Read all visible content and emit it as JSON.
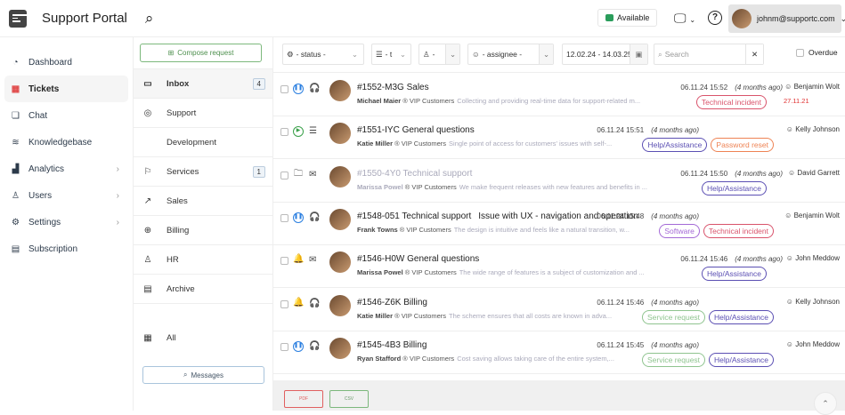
{
  "header": {
    "title": "Support Portal",
    "status": "Available",
    "user": "johnm@supportc.com"
  },
  "sidebar": {
    "items": [
      {
        "label": "Dashboard",
        "icon": "gauge-icon"
      },
      {
        "label": "Tickets",
        "icon": "grid-icon",
        "active": true
      },
      {
        "label": "Chat",
        "icon": "chat-icon"
      },
      {
        "label": "Knowledgebase",
        "icon": "layers-icon"
      },
      {
        "label": "Analytics",
        "icon": "chart-icon",
        "chevron": true
      },
      {
        "label": "Users",
        "icon": "users-icon",
        "chevron": true
      },
      {
        "label": "Settings",
        "icon": "gear-icon",
        "chevron": true
      },
      {
        "label": "Subscription",
        "icon": "calendar-icon"
      }
    ]
  },
  "folders": {
    "compose": "Compose request",
    "items": [
      {
        "label": "Inbox",
        "count": "4",
        "active": true,
        "g": "▭"
      },
      {
        "label": "Support",
        "g": "◎"
      },
      {
        "label": "Development",
        "g": "</>"
      },
      {
        "label": "Services",
        "count": "1",
        "g": "⚐"
      },
      {
        "label": "Sales",
        "g": "↗"
      },
      {
        "label": "Billing",
        "g": "⊕"
      },
      {
        "label": "HR",
        "g": "♙"
      },
      {
        "label": "Archive",
        "g": "▤"
      }
    ],
    "all": "All",
    "messages": "Messages"
  },
  "filters": {
    "status": "- status -",
    "type": "- t",
    "group": "-",
    "assignee": "- assignee -",
    "date": "12.02.24 - 14.03.25",
    "search_placeholder": "Search",
    "overdue": "Overdue"
  },
  "tickets": [
    {
      "title": "#1552-M3G Sales",
      "extra": "",
      "name": "Michael Maier",
      "group": "VIP Customers",
      "preview": "Collecting and providing real-time data for support-related m...",
      "date": "06.11.24 15:52",
      "ago": "(4 months ago)",
      "tags": [
        {
          "t": "Technical incident",
          "c": "#d9536b"
        }
      ],
      "assignee": "Benjamin Wolt",
      "due": "27.11.21",
      "status": "pause",
      "channel": "headset"
    },
    {
      "title": "#1551-IYC General questions",
      "extra": "",
      "name": "Katie Miller",
      "group": "VIP Customers",
      "preview": "Single point of access for customers' issues with self-...",
      "date": "06.11.24 15:51",
      "ago": "(4 months ago)",
      "tags": [
        {
          "t": "Help/Assistance",
          "c": "#5b4fb3"
        },
        {
          "t": "Password reset",
          "c": "#ee8354"
        }
      ],
      "assignee": "Kelly Johnson",
      "status": "play",
      "channel": "form"
    },
    {
      "title": "#1550-4Y0 Technical support",
      "extra": "",
      "name": "Marissa Powel",
      "group": "VIP Customers",
      "preview": "We make frequent releases with new features and benefits in ...",
      "date": "06.11.24 15:50",
      "ago": "(4 months ago)",
      "tags": [
        {
          "t": "Help/Assistance",
          "c": "#5b4fb3"
        }
      ],
      "assignee": "David Garrett",
      "status": "folder",
      "channel": "mail",
      "dim": true
    },
    {
      "title": "#1548-051 Technical support",
      "extra": "Issue with UX - navigation and operation",
      "name": "Frank Towns",
      "group": "VIP Customers",
      "preview": "The design is intuitive and feels like a natural transition, w...",
      "date": "06.11.24 15:48",
      "ago": "(4 months ago)",
      "tags": [
        {
          "t": "Software",
          "c": "#a46ad6"
        },
        {
          "t": "Technical incident",
          "c": "#d9536b"
        }
      ],
      "assignee": "Benjamin Wolt",
      "status": "pause",
      "channel": "headset"
    },
    {
      "title": "#1546-H0W General questions",
      "extra": "",
      "name": "Marissa Powel",
      "group": "VIP Customers",
      "preview": "The wide range of features is a subject of customization and ...",
      "date": "06.11.24 15:46",
      "ago": "(4 months ago)",
      "tags": [
        {
          "t": "Help/Assistance",
          "c": "#5b4fb3"
        }
      ],
      "assignee": "John Meddow",
      "status": "bell",
      "channel": "mail"
    },
    {
      "title": "#1546-Z6K Billing",
      "extra": "",
      "name": "Katie Miller",
      "group": "VIP Customers",
      "preview": "The scheme ensures that all costs are known in adva...",
      "date": "06.11.24 15:46",
      "ago": "(4 months ago)",
      "tags": [
        {
          "t": "Service request",
          "c": "#8fc48f"
        },
        {
          "t": "Help/Assistance",
          "c": "#5b4fb3"
        }
      ],
      "assignee": "Kelly Johnson",
      "status": "bell",
      "channel": "headset"
    },
    {
      "title": "#1545-4B3 Billing",
      "extra": "",
      "name": "Ryan Stafford",
      "group": "VIP Customers",
      "preview": "Cost saving allows taking care of the entire system,...",
      "date": "06.11.24 15:45",
      "ago": "(4 months ago)",
      "tags": [
        {
          "t": "Service request",
          "c": "#8fc48f"
        },
        {
          "t": "Help/Assistance",
          "c": "#5b4fb3"
        }
      ],
      "assignee": "John Meddow",
      "status": "pause",
      "channel": "headset"
    }
  ],
  "footer": {
    "pdf": "PDF",
    "csv": "CSV"
  }
}
